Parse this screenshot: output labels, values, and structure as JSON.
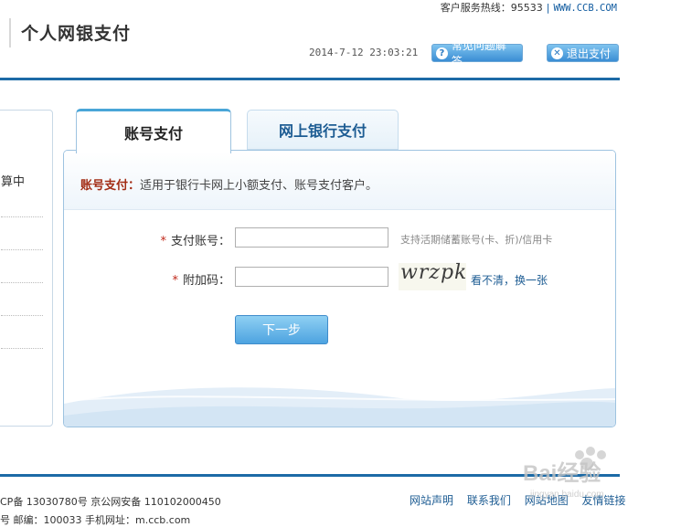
{
  "header": {
    "hotline_label": "客户服务热线：95533",
    "hotline_sep": "|",
    "hotline_link": "WWW.CCB.COM",
    "title": "个人网银支付",
    "datetime": "2014-7-12 23:03:21",
    "faq_button": "常见问题解答",
    "logout_button": "退出支付"
  },
  "sidebar": {
    "partial_text": "算中"
  },
  "tabs": [
    {
      "label": "账号支付"
    },
    {
      "label": "网上银行支付"
    }
  ],
  "form": {
    "desc_highlight": "账号支付：",
    "desc_text": "适用于银行卡网上小额支付、账号支付客户。",
    "account_label": "支付账号：",
    "account_value": "",
    "account_hint": "支持活期储蓄账号(卡、折)/信用卡",
    "code_label": "附加码：",
    "code_value": "",
    "captcha_text": "wrzpk",
    "refresh_link": "看不清，换一张",
    "required_mark": "*",
    "next_button": "下一步"
  },
  "footer": {
    "icp_text": "CP备 13030780号 京公网安备 110102000450",
    "line2_text": "号    邮编：100033    手机网址：m.ccb.com",
    "links": [
      "网站声明",
      "联系我们",
      "网站地图",
      "友情链接"
    ]
  },
  "watermark": {
    "text": "Bai经验",
    "sub": "jingyan.baidu.com"
  },
  "colors": {
    "accent_blue": "#1c6aa6",
    "highlight_red": "#a22c14",
    "link_blue": "#1d5c93"
  }
}
